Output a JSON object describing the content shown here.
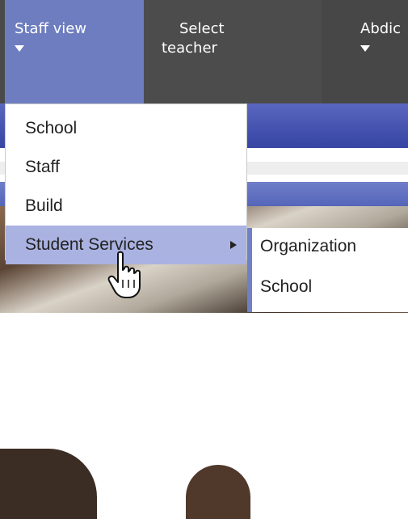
{
  "nav": {
    "tabs": [
      {
        "label": "Staff view",
        "has_dropdown": true,
        "active": true
      },
      {
        "label": "Select teacher",
        "has_dropdown": false,
        "active": false
      },
      {
        "label": "Abdic",
        "has_dropdown": true,
        "active": false
      }
    ],
    "teacher_line1": "Select",
    "teacher_line2": "teacher"
  },
  "dropdown": {
    "items": [
      {
        "label": "School"
      },
      {
        "label": "Staff"
      },
      {
        "label": "Build"
      },
      {
        "label": "Student Services",
        "has_submenu": true,
        "highlighted": true
      }
    ]
  },
  "submenu": {
    "items": [
      {
        "label": "Organization"
      },
      {
        "label": "School"
      }
    ]
  },
  "colors": {
    "nav_bg": "#4a4a4a",
    "active_tab": "#6d7dbf",
    "highlight": "#a9b2e0",
    "submenu_accent": "#7080c4"
  },
  "icons": [
    "caret-down-icon",
    "arrow-right-icon",
    "hand-pointer-cursor-icon"
  ]
}
